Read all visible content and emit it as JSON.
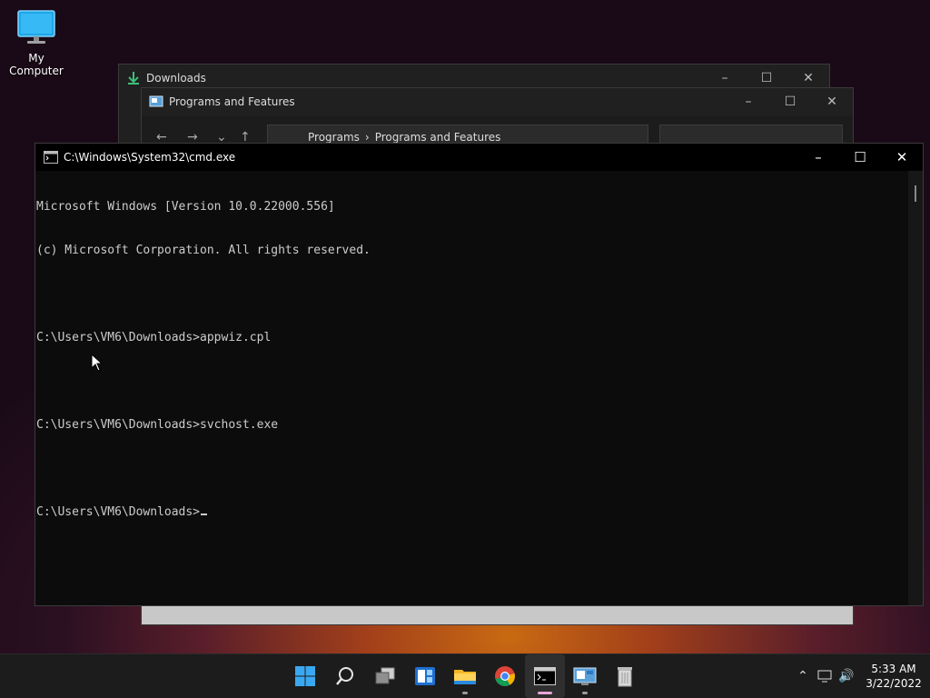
{
  "desktop": {
    "icon_label": "My Computer",
    "icon_name": "monitor-icon"
  },
  "downloads_window": {
    "title": "Downloads",
    "icon": "download-arrow-icon",
    "accent": "#3dbf7a"
  },
  "programs_window": {
    "title": "Programs and Features",
    "breadcrumb": [
      "Programs",
      "Programs and Features"
    ],
    "icon": "control-panel-icon"
  },
  "cmd_window": {
    "title": "C:\\Windows\\System32\\cmd.exe",
    "lines": [
      "Microsoft Windows [Version 10.0.22000.556]",
      "(c) Microsoft Corporation. All rights reserved.",
      "",
      "C:\\Users\\VM6\\Downloads>appwiz.cpl",
      "",
      "C:\\Users\\VM6\\Downloads>svchost.exe",
      "",
      "C:\\Users\\VM6\\Downloads>"
    ]
  },
  "taskbar": {
    "apps": [
      "start",
      "search",
      "task-view",
      "widgets",
      "file-explorer",
      "chrome",
      "cmd",
      "control-panel",
      "recycle-bin"
    ],
    "clock": {
      "time": "5:33 AM",
      "date": "3/22/2022"
    }
  }
}
